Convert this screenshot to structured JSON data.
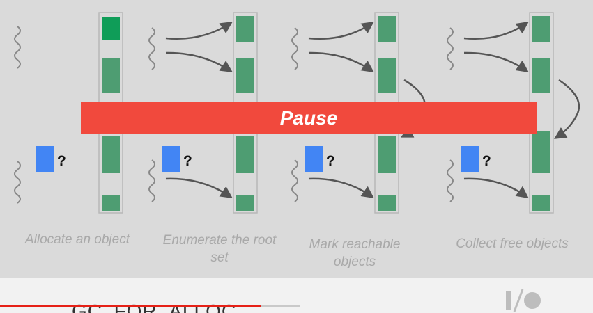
{
  "banner": {
    "label": "Pause"
  },
  "steps": [
    {
      "label": "Allocate an object"
    },
    {
      "label": "Enumerate the root set"
    },
    {
      "label": "Mark reachable objects"
    },
    {
      "label": "Collect free objects"
    }
  ],
  "unknown_marker": "?",
  "video": {
    "caption": "GC_FOR_ALLOC",
    "progress": 0.87
  },
  "colors": {
    "background": "#dadada",
    "object_green": "#4e9d72",
    "new_object_green": "#0f9d58",
    "new_object_blue": "#4285f4",
    "pause_red": "#f1493d",
    "arrow": "#555555",
    "progress_red": "#e62117"
  },
  "icons": [
    "wavy-thread-icon",
    "arrow-icon",
    "io-logo"
  ]
}
